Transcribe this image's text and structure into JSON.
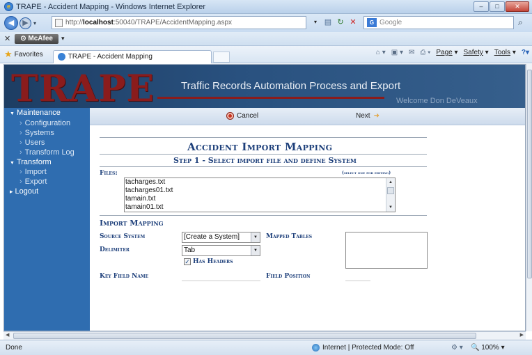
{
  "browser": {
    "window_title": "TRAPE - Accident Mapping - Windows Internet Explorer",
    "url_prefix": "http://",
    "url_host": "localhost",
    "url_rest": ":50040/TRAPE/AccidentMapping.aspx",
    "search_placeholder": "Google",
    "mcafee_label": "McAfee",
    "favorites_label": "Favorites",
    "tab_title": "TRAPE - Accident Mapping",
    "commands": [
      "Page",
      "Safety",
      "Tools"
    ],
    "status_left": "Done",
    "status_zone": "Internet | Protected Mode: Off",
    "zoom": "100%"
  },
  "header": {
    "logo": "TRAPE",
    "tagline": "Traffic Records Automation Process and Export",
    "welcome": "Welcome Don DeVeaux"
  },
  "sidebar": {
    "maintenance": "Maintenance",
    "configuration": "Configuration",
    "systems": "Systems",
    "users": "Users",
    "transform_log": "Transform Log",
    "transform": "Transform",
    "import": "Import",
    "export": "Export",
    "logout": "Logout"
  },
  "toolbar": {
    "cancel_label": "Cancel",
    "next_label": "Next"
  },
  "form": {
    "title": "Accident Import Mapping",
    "step": "Step 1 - Select import file and define System",
    "files_label": "Files:",
    "files_hint": "(select one for editing)",
    "files": [
      "tacharges.txt",
      "tacharges01.txt",
      "tamain.txt",
      "tamain01.txt"
    ],
    "section_label": "Import Mapping",
    "source_system_label": "Source System",
    "source_system_value": "[Create a System]",
    "delimiter_label": "Delimiter",
    "delimiter_value": "Tab",
    "has_headers_label": "Has Headers",
    "has_headers_checked": true,
    "mapped_tables_label": "Mapped Tables",
    "key_field_label": "Key Field Name",
    "field_position_label": "Field Position"
  }
}
